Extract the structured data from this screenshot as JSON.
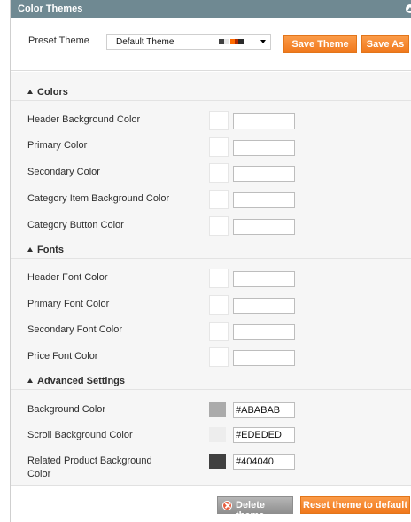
{
  "panel": {
    "title": "Color Themes"
  },
  "preset": {
    "label": "Preset Theme",
    "value": "Default Theme",
    "swatch_colors": [
      "#404040",
      "#e6e6e6",
      "#ff6b00",
      "#b22a00",
      "#2b2b2b"
    ],
    "save_label": "Save Theme",
    "save_as_label": "Save As"
  },
  "groups": {
    "colors": {
      "title": "Colors",
      "rows": [
        {
          "label": "Header Background Color",
          "value": ""
        },
        {
          "label": "Primary Color",
          "value": ""
        },
        {
          "label": "Secondary Color",
          "value": ""
        },
        {
          "label": "Category Item Background Color",
          "value": ""
        },
        {
          "label": "Category Button Color",
          "value": ""
        }
      ]
    },
    "fonts": {
      "title": "Fonts",
      "rows": [
        {
          "label": "Header Font Color",
          "value": ""
        },
        {
          "label": "Primary Font Color",
          "value": ""
        },
        {
          "label": "Secondary Font Color",
          "value": ""
        },
        {
          "label": "Price Font Color",
          "value": ""
        }
      ]
    },
    "advanced": {
      "title": "Advanced Settings",
      "rows": [
        {
          "label": "Background Color",
          "value": "#ABABAB",
          "color": "#ABABAB"
        },
        {
          "label": "Scroll Background Color",
          "value": "#EDEDED",
          "color": "#EDEDED"
        },
        {
          "label": "Related Product Background Color",
          "value": "#404040",
          "color": "#404040"
        }
      ]
    }
  },
  "footer": {
    "delete_label": "Delete theme",
    "reset_label": "Reset theme to default"
  }
}
